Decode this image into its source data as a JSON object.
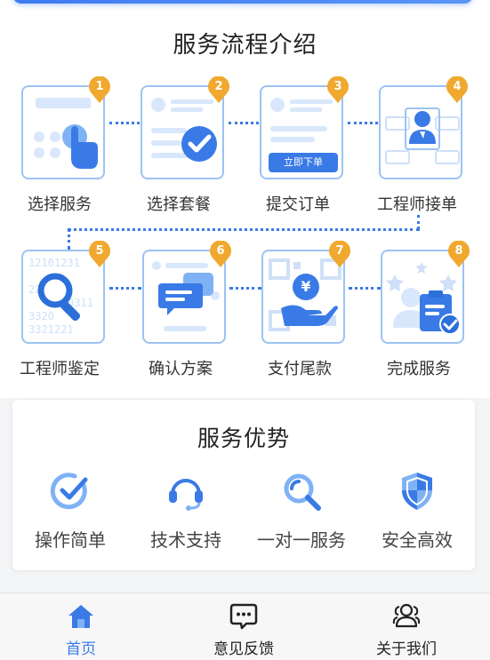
{
  "process": {
    "title": "服务流程介绍",
    "steps": [
      {
        "num": "1",
        "label": "选择服务",
        "icon": "tap-icon"
      },
      {
        "num": "2",
        "label": "选择套餐",
        "icon": "checklist-icon"
      },
      {
        "num": "3",
        "label": "提交订单",
        "icon": "order-form-icon",
        "button_text": "立即下单"
      },
      {
        "num": "4",
        "label": "工程师接单",
        "icon": "engineer-network-icon"
      },
      {
        "num": "5",
        "label": "工程师鉴定",
        "icon": "magnifier-icon",
        "code_text": [
          "12101231",
          "22",
          "0311",
          "3320",
          "3321221"
        ]
      },
      {
        "num": "6",
        "label": "确认方案",
        "icon": "chat-icon"
      },
      {
        "num": "7",
        "label": "支付尾款",
        "icon": "qr-payment-icon",
        "currency": "¥"
      },
      {
        "num": "8",
        "label": "完成服务",
        "icon": "clipboard-check-icon"
      }
    ]
  },
  "advantages": {
    "title": "服务优势",
    "items": [
      {
        "label": "操作简单",
        "icon": "check-circle-icon"
      },
      {
        "label": "技术支持",
        "icon": "headset-icon"
      },
      {
        "label": "一对一服务",
        "icon": "search-service-icon"
      },
      {
        "label": "安全高效",
        "icon": "shield-icon"
      }
    ]
  },
  "tabbar": {
    "items": [
      {
        "label": "首页",
        "icon": "home-icon",
        "active": true
      },
      {
        "label": "意见反馈",
        "icon": "feedback-icon",
        "active": false
      },
      {
        "label": "关于我们",
        "icon": "users-icon",
        "active": false
      }
    ]
  },
  "colors": {
    "accent": "#3a7ae6",
    "badge": "#f0a92e",
    "card_border": "#9cc3f2"
  }
}
